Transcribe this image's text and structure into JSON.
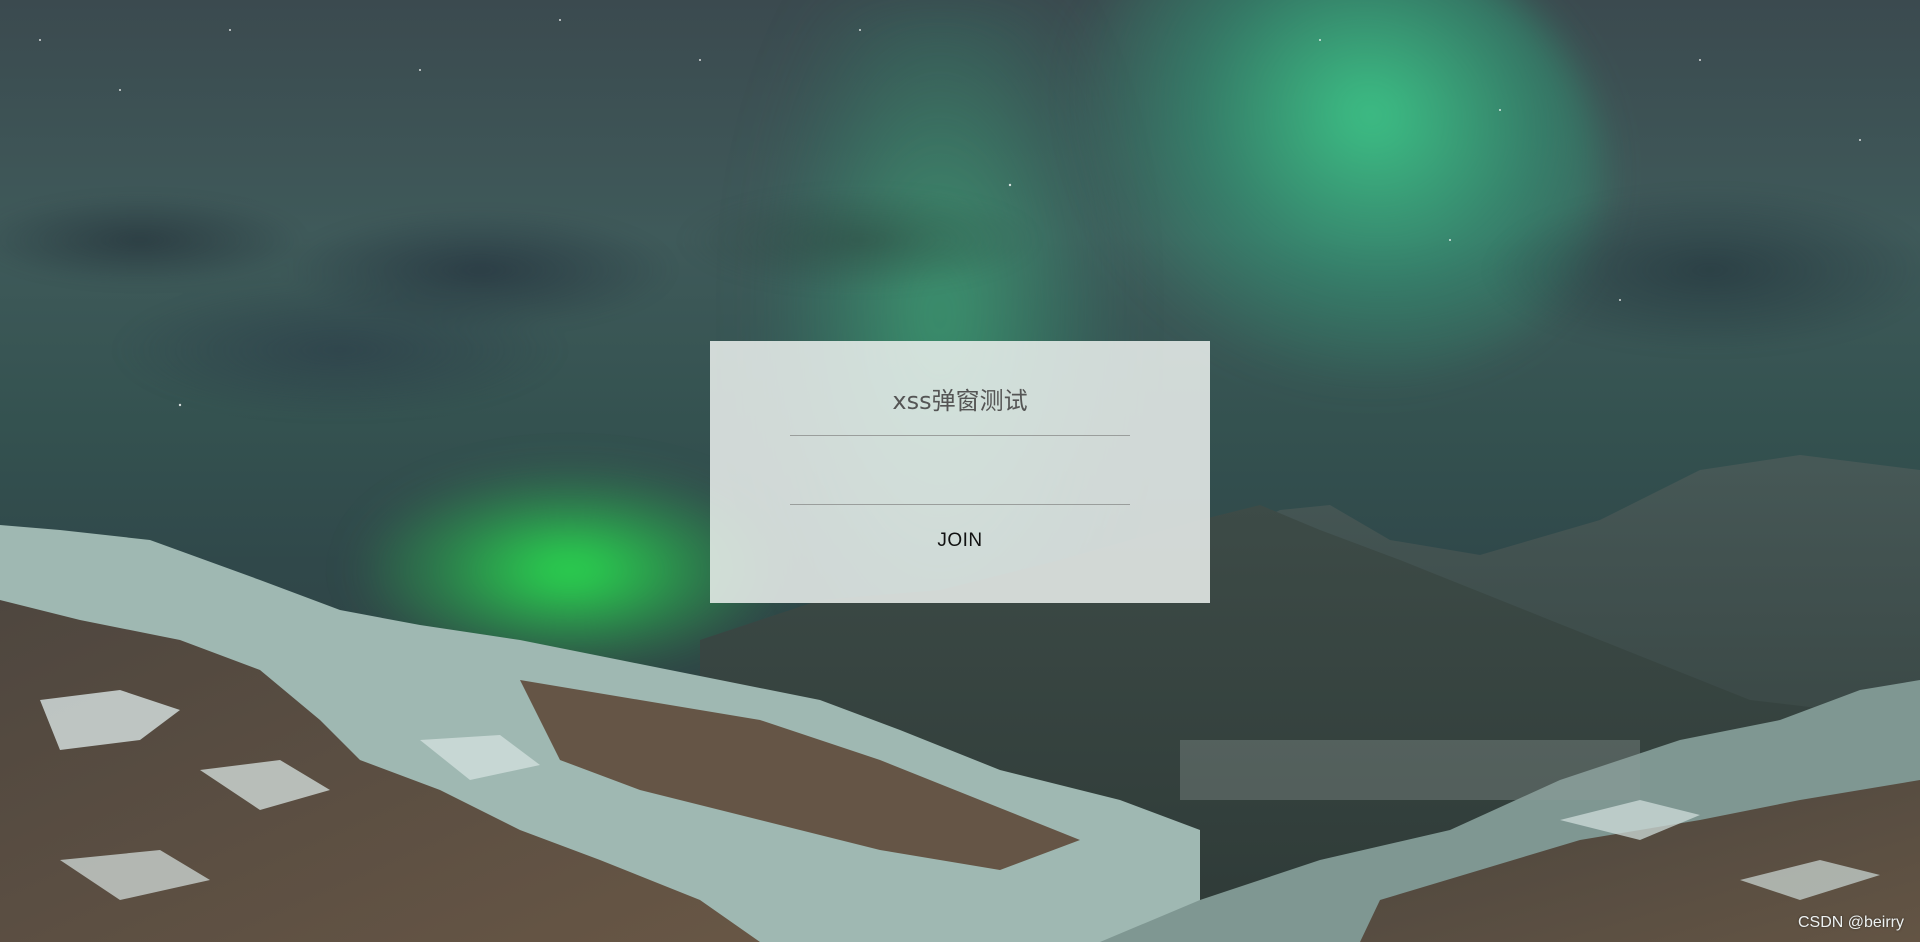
{
  "page": {
    "background_description_colors": {
      "sky": "#3b4a4f",
      "aurora_green": "#36e08a",
      "mountain_snow": "#c9d6d3"
    }
  },
  "form": {
    "title": "xss弹窗测试",
    "name_input_value": "",
    "second_input_value": "",
    "join_label": "JOIN"
  },
  "footer": {
    "watermark": "CSDN @beirry"
  }
}
